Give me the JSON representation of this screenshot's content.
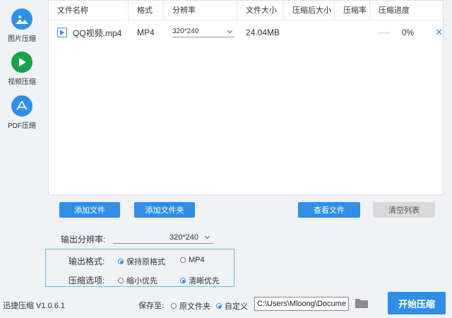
{
  "sidebar": {
    "items": [
      {
        "label": "图片压缩",
        "icon": "image-icon"
      },
      {
        "label": "视频压缩",
        "icon": "play-icon"
      },
      {
        "label": "PDF压缩",
        "icon": "pdf-icon"
      }
    ]
  },
  "table": {
    "columns": [
      "文件名称",
      "格式",
      "分辨率",
      "文件大小",
      "压缩后大小",
      "压缩率",
      "压缩进度"
    ],
    "rows": [
      {
        "name": "QQ视频.mp4",
        "format": "MP4",
        "resolution": "320*240",
        "size": "24.04MB",
        "compressed_size": "",
        "ratio": "",
        "progress": 0,
        "progress_text": "0%"
      }
    ]
  },
  "buttons": {
    "add_file": "添加文件",
    "add_folder": "添加文件夹",
    "view_file": "查看文件",
    "clear_list": "清空列表",
    "start": "开始压缩"
  },
  "settings": {
    "output_res_label": "输出分辨率:",
    "output_res_value": "320*240",
    "format_label": "输出格式:",
    "format_options": [
      "保持原格式",
      "MP4"
    ],
    "format_selected": 0,
    "compress_label": "压缩选项:",
    "compress_options": [
      "缩小优先",
      "清晰优先"
    ],
    "compress_selected": 1
  },
  "footer": {
    "version": "迅捷压缩 V1.0.6.1",
    "save_to_label": "保存至:",
    "save_options": [
      "原文件夹",
      "自定义"
    ],
    "save_selected": 1,
    "path": "C:\\Users\\Mloong\\Docume"
  },
  "colors": {
    "accent": "#2f8fe6",
    "sidebar_icon_inactive": "#2f8fe6",
    "sidebar_icon_active": "#1aa34a",
    "highlight_border": "#5fc3e4"
  }
}
